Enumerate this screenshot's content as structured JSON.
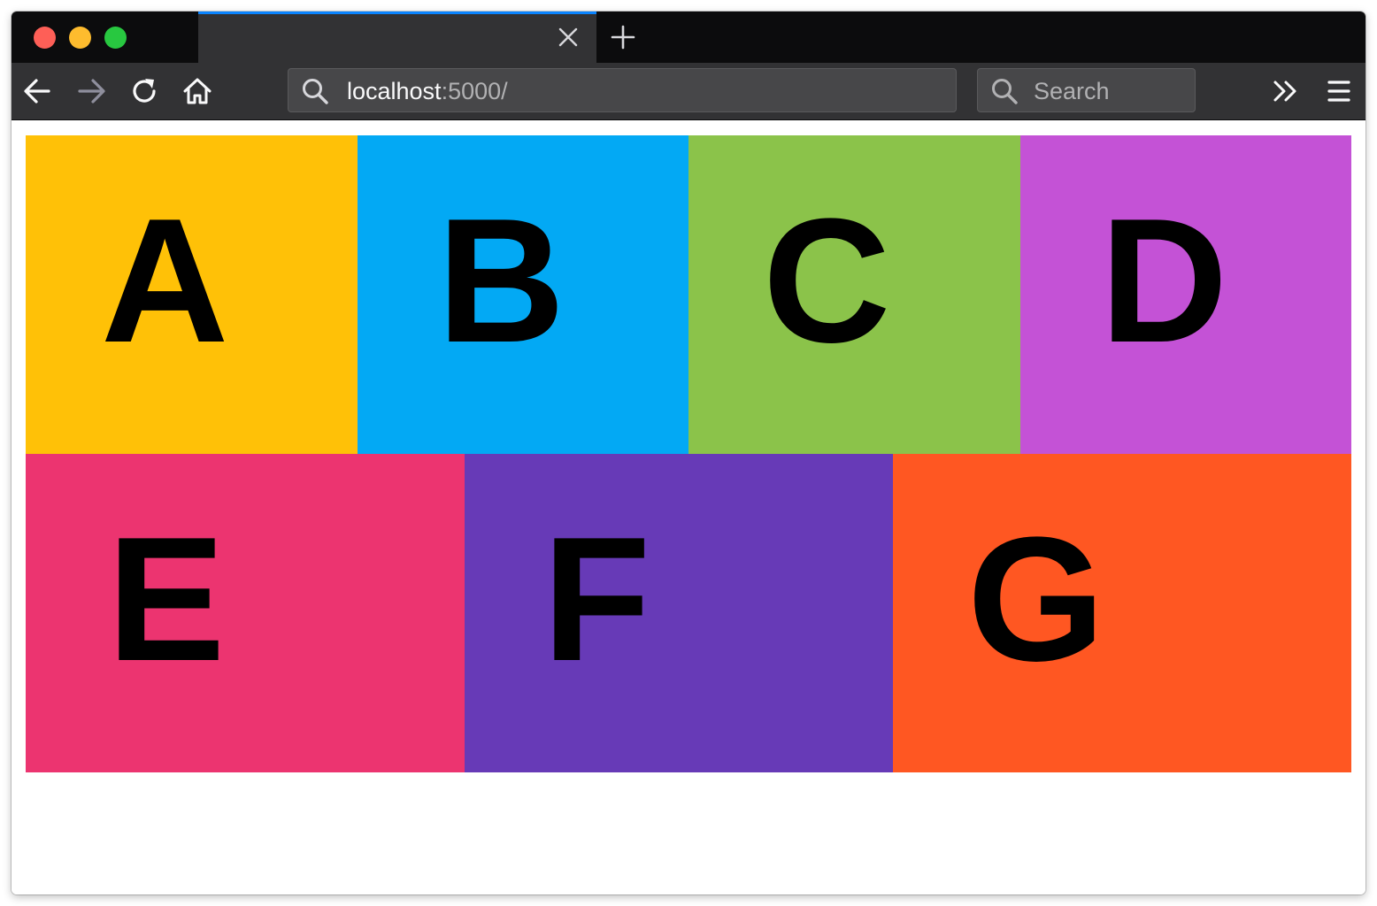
{
  "browser": {
    "tab": {
      "title": ""
    },
    "url": {
      "host": "localhost",
      "port": ":5000/"
    },
    "search": {
      "placeholder": "Search"
    }
  },
  "colors": {
    "a": "#ffc107",
    "b": "#03a9f4",
    "c": "#8bc34a",
    "d": "#c452d6",
    "e": "#ec3470",
    "f": "#673ab7",
    "g": "#ff5722"
  },
  "boxes": {
    "row1": [
      {
        "letter": "A",
        "color": "#ffc107"
      },
      {
        "letter": "B",
        "color": "#03a9f4"
      },
      {
        "letter": "C",
        "color": "#8bc34a"
      },
      {
        "letter": "D",
        "color": "#c452d6"
      }
    ],
    "row2": [
      {
        "letter": "E",
        "color": "#ec3470"
      },
      {
        "letter": "F",
        "color": "#673ab7"
      },
      {
        "letter": "G",
        "color": "#ff5722"
      }
    ]
  },
  "icons": {
    "back": "back-arrow-icon",
    "forward": "forward-arrow-icon",
    "reload": "reload-icon",
    "home": "home-icon",
    "search": "search-icon",
    "overflow": "double-chevron-icon",
    "menu": "hamburger-menu-icon",
    "close": "close-icon",
    "new_tab": "plus-icon"
  }
}
